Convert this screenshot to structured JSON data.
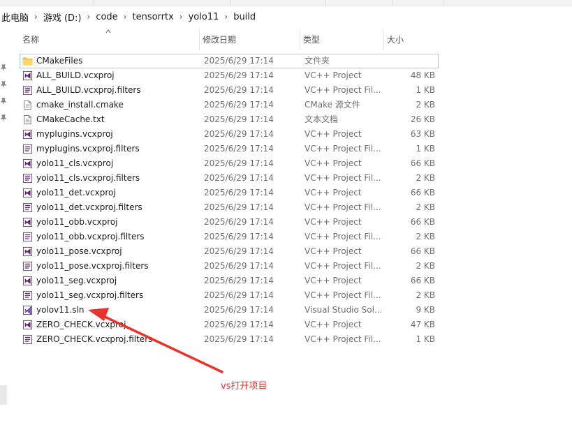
{
  "breadcrumb": [
    "此电脑",
    "游戏 (D:)",
    "code",
    "tensorrtx",
    "yolo11",
    "build"
  ],
  "breadcrumb_separator": "›",
  "columns": {
    "name": "名称",
    "date": "修改日期",
    "type": "类型",
    "size": "大小"
  },
  "files": [
    {
      "name": "CMakeFiles",
      "date": "2025/6/29 17:14",
      "type": "文件夹",
      "size": "",
      "icon": "folder-icon"
    },
    {
      "name": "ALL_BUILD.vcxproj",
      "date": "2025/6/29 17:14",
      "type": "VC++ Project",
      "size": "48 KB",
      "icon": "vcxproj-icon"
    },
    {
      "name": "ALL_BUILD.vcxproj.filters",
      "date": "2025/6/29 17:14",
      "type": "VC++ Project Fil...",
      "size": "1 KB",
      "icon": "filters-icon"
    },
    {
      "name": "cmake_install.cmake",
      "date": "2025/6/29 17:14",
      "type": "CMake 源文件",
      "size": "2 KB",
      "icon": "cmake-file-icon"
    },
    {
      "name": "CMakeCache.txt",
      "date": "2025/6/29 17:14",
      "type": "文本文档",
      "size": "26 KB",
      "icon": "text-file-icon"
    },
    {
      "name": "myplugins.vcxproj",
      "date": "2025/6/29 17:14",
      "type": "VC++ Project",
      "size": "63 KB",
      "icon": "vcxproj-icon"
    },
    {
      "name": "myplugins.vcxproj.filters",
      "date": "2025/6/29 17:14",
      "type": "VC++ Project Fil...",
      "size": "1 KB",
      "icon": "filters-icon"
    },
    {
      "name": "yolo11_cls.vcxproj",
      "date": "2025/6/29 17:14",
      "type": "VC++ Project",
      "size": "66 KB",
      "icon": "vcxproj-icon"
    },
    {
      "name": "yolo11_cls.vcxproj.filters",
      "date": "2025/6/29 17:14",
      "type": "VC++ Project Fil...",
      "size": "2 KB",
      "icon": "filters-icon"
    },
    {
      "name": "yolo11_det.vcxproj",
      "date": "2025/6/29 17:14",
      "type": "VC++ Project",
      "size": "66 KB",
      "icon": "vcxproj-icon"
    },
    {
      "name": "yolo11_det.vcxproj.filters",
      "date": "2025/6/29 17:14",
      "type": "VC++ Project Fil...",
      "size": "2 KB",
      "icon": "filters-icon"
    },
    {
      "name": "yolo11_obb.vcxproj",
      "date": "2025/6/29 17:14",
      "type": "VC++ Project",
      "size": "66 KB",
      "icon": "vcxproj-icon"
    },
    {
      "name": "yolo11_obb.vcxproj.filters",
      "date": "2025/6/29 17:14",
      "type": "VC++ Project Fil...",
      "size": "2 KB",
      "icon": "filters-icon"
    },
    {
      "name": "yolo11_pose.vcxproj",
      "date": "2025/6/29 17:14",
      "type": "VC++ Project",
      "size": "66 KB",
      "icon": "vcxproj-icon"
    },
    {
      "name": "yolo11_pose.vcxproj.filters",
      "date": "2025/6/29 17:14",
      "type": "VC++ Project Fil...",
      "size": "2 KB",
      "icon": "filters-icon"
    },
    {
      "name": "yolo11_seg.vcxproj",
      "date": "2025/6/29 17:14",
      "type": "VC++ Project",
      "size": "66 KB",
      "icon": "vcxproj-icon"
    },
    {
      "name": "yolo11_seg.vcxproj.filters",
      "date": "2025/6/29 17:14",
      "type": "VC++ Project Fil...",
      "size": "2 KB",
      "icon": "filters-icon"
    },
    {
      "name": "yolov11.sln",
      "date": "2025/6/29 17:14",
      "type": "Visual Studio Sol...",
      "size": "9 KB",
      "icon": "sln-icon"
    },
    {
      "name": "ZERO_CHECK.vcxproj",
      "date": "2025/6/29 17:14",
      "type": "VC++ Project",
      "size": "47 KB",
      "icon": "vcxproj-icon"
    },
    {
      "name": "ZERO_CHECK.vcxproj.filters",
      "date": "2025/6/29 17:14",
      "type": "VC++ Project Fil...",
      "size": "1 KB",
      "icon": "filters-icon"
    }
  ],
  "annotation": {
    "text": "vs打开项目",
    "color": "#e8322b"
  },
  "colors": {
    "focus_border": "#99d1ff",
    "folder": "#f5c94c",
    "vs_purple": "#68217a",
    "annotation": "#e8322b"
  }
}
